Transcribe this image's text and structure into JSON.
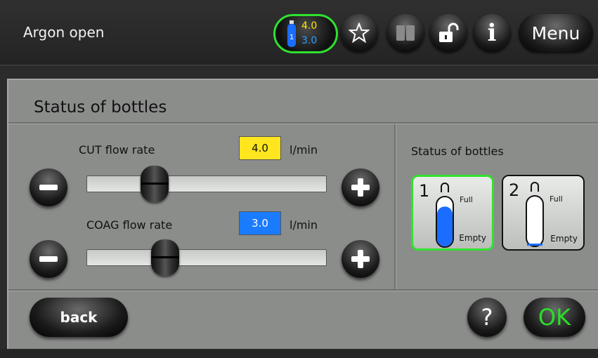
{
  "header": {
    "title": "Argon open",
    "gas_indicator": {
      "bottle_number": "1",
      "cut_value": "4.0",
      "coag_value": "3.0"
    },
    "icons": {
      "favorite": "star-icon",
      "manual": "book-icon",
      "lock": "unlock-icon",
      "info": "info-icon"
    },
    "info_glyph": "i",
    "menu_label": "Menu"
  },
  "panel": {
    "title": "Status of bottles",
    "cut": {
      "label": "CUT flow rate",
      "value": "4.0",
      "unit": "l/min",
      "slider_fraction": 0.25
    },
    "coag": {
      "label": "COAG flow rate",
      "value": "3.0",
      "unit": "l/min",
      "slider_fraction": 0.3
    },
    "bottles": {
      "title": "Status of bottles",
      "items": [
        {
          "number": "1",
          "full_label": "Full",
          "empty_label": "Empty",
          "fill_color": "#1a6dff",
          "fill_fraction": 0.8,
          "selected": true
        },
        {
          "number": "2",
          "full_label": "Full",
          "empty_label": "Empty",
          "fill_color": "#ffffff",
          "fill_fraction": 0.04,
          "selected": false
        }
      ]
    }
  },
  "footer": {
    "back_label": "back",
    "help_label": "?",
    "ok_label": "OK"
  },
  "colors": {
    "accent_green": "#2fe22f",
    "cut_yellow": "#ffe61e",
    "coag_blue": "#1a7bff"
  }
}
